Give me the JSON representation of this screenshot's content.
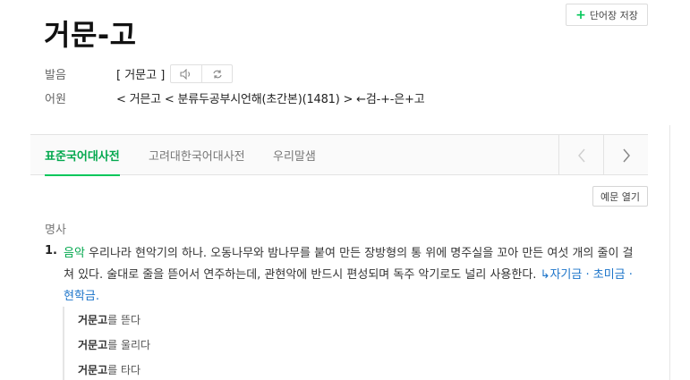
{
  "toolbar": {
    "save_label": "단어장 저장"
  },
  "entry": {
    "headword": "거문-고"
  },
  "pronunciation": {
    "label": "발음",
    "value": "[ 거문고 ]"
  },
  "etymology": {
    "label": "어원",
    "value": "< 거믄고 < 분류두공부시언해(초간본)(1481) > ←검-+-은+고"
  },
  "tabs": [
    {
      "label": "표준국어대사전",
      "active": true
    },
    {
      "label": "고려대한국어대사전",
      "active": false
    },
    {
      "label": "우리말샘",
      "active": false
    }
  ],
  "example_toggle": {
    "label": "예문 열기"
  },
  "definition": {
    "part_of_speech": "명사",
    "number": "1.",
    "category": "음악",
    "text": " 우리나라 현악기의 하나. 오동나무와 밤나무를 붙여 만든 장방형의 통 위에 명주실을 꼬아 만든 여섯 개의 줄이 걸쳐 있다. 술대로 줄을 뜯어서 연주하는데, 관현악에 반드시 편성되며 독주 악기로도 널리 사용한다. ",
    "related_arrow": "↳",
    "related": "자기금 · 초미금 · 현학금."
  },
  "examples": [
    {
      "headword": "거문고",
      "rest": "를 뜯다"
    },
    {
      "headword": "거문고",
      "rest": "를 울리다"
    },
    {
      "headword": "거문고",
      "rest": "를 타다"
    }
  ],
  "colors": {
    "accent": "#03c75a",
    "link": "#1a73c9"
  }
}
